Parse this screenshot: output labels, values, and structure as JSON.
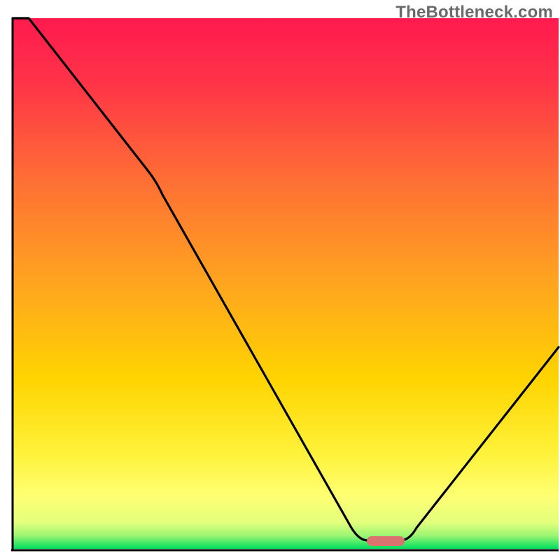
{
  "watermark": "TheBottleneck.com",
  "chart_data": {
    "type": "line",
    "title": "",
    "xlabel": "",
    "ylabel": "",
    "xlim": [
      0,
      100
    ],
    "ylim": [
      0,
      100
    ],
    "grid": false,
    "legend": false,
    "colors": {
      "gradient_top": "#ff1a4d",
      "gradient_mid1": "#ff722d",
      "gradient_mid2": "#ffd500",
      "gradient_low": "#ffff60",
      "gradient_bottom": "#00e060",
      "line": "#000000",
      "marker": "#d9706e",
      "axes": "#000000"
    },
    "x": [
      0,
      3,
      25,
      27,
      62,
      65,
      71,
      74,
      100
    ],
    "y": [
      100,
      100,
      71,
      68,
      4,
      1.5,
      1.5,
      4,
      38
    ],
    "marker": {
      "x_start": 65,
      "x_end": 72,
      "y": 1.5
    },
    "description": "Single black curve on a vertical rainbow gradient background (red at top through orange/yellow to green at bottom). Curve starts at the top-left corner, descends to the right with a slight knee around x≈26, reaches a flat minimum near the bottom around x≈65–72, then rises sharply toward the right edge. A small salmon-colored rounded marker sits on the flat minimum. Axes are black lines on the left and bottom with no ticks, labels, or gridlines."
  }
}
